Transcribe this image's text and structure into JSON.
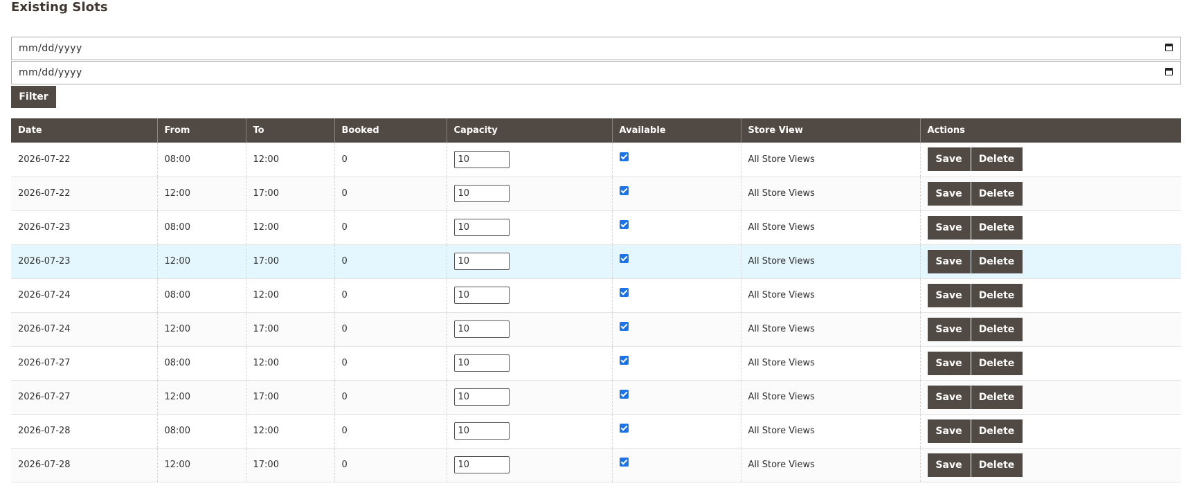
{
  "title": "Existing Slots",
  "filters": {
    "date_from_placeholder": "mm/dd/yyyy",
    "date_to_placeholder": "mm/dd/yyyy",
    "filter_label": "Filter"
  },
  "table": {
    "headers": [
      "Date",
      "From",
      "To",
      "Booked",
      "Capacity",
      "Available",
      "Store View",
      "Actions"
    ],
    "save_label": "Save",
    "delete_label": "Delete",
    "rows": [
      {
        "date": "2026-07-22",
        "from": "08:00",
        "to": "12:00",
        "booked": "0",
        "capacity": "10",
        "available": true,
        "store_view": "All Store Views"
      },
      {
        "date": "2026-07-22",
        "from": "12:00",
        "to": "17:00",
        "booked": "0",
        "capacity": "10",
        "available": true,
        "store_view": "All Store Views"
      },
      {
        "date": "2026-07-23",
        "from": "08:00",
        "to": "12:00",
        "booked": "0",
        "capacity": "10",
        "available": true,
        "store_view": "All Store Views"
      },
      {
        "date": "2026-07-23",
        "from": "12:00",
        "to": "17:00",
        "booked": "0",
        "capacity": "10",
        "available": true,
        "store_view": "All Store Views"
      },
      {
        "date": "2026-07-24",
        "from": "08:00",
        "to": "12:00",
        "booked": "0",
        "capacity": "10",
        "available": true,
        "store_view": "All Store Views"
      },
      {
        "date": "2026-07-24",
        "from": "12:00",
        "to": "17:00",
        "booked": "0",
        "capacity": "10",
        "available": true,
        "store_view": "All Store Views"
      },
      {
        "date": "2026-07-27",
        "from": "08:00",
        "to": "12:00",
        "booked": "0",
        "capacity": "10",
        "available": true,
        "store_view": "All Store Views"
      },
      {
        "date": "2026-07-27",
        "from": "12:00",
        "to": "17:00",
        "booked": "0",
        "capacity": "10",
        "available": true,
        "store_view": "All Store Views"
      },
      {
        "date": "2026-07-28",
        "from": "08:00",
        "to": "12:00",
        "booked": "0",
        "capacity": "10",
        "available": true,
        "store_view": "All Store Views"
      },
      {
        "date": "2026-07-28",
        "from": "12:00",
        "to": "17:00",
        "booked": "0",
        "capacity": "10",
        "available": true,
        "store_view": "All Store Views"
      }
    ]
  },
  "colors": {
    "header_bg": "#514943",
    "button_bg": "#514943",
    "row_hover": "#e5f7fe",
    "checkbox": "#1a73e8"
  },
  "icons": [
    "calendar-icon",
    "checkbox-checked-icon"
  ]
}
